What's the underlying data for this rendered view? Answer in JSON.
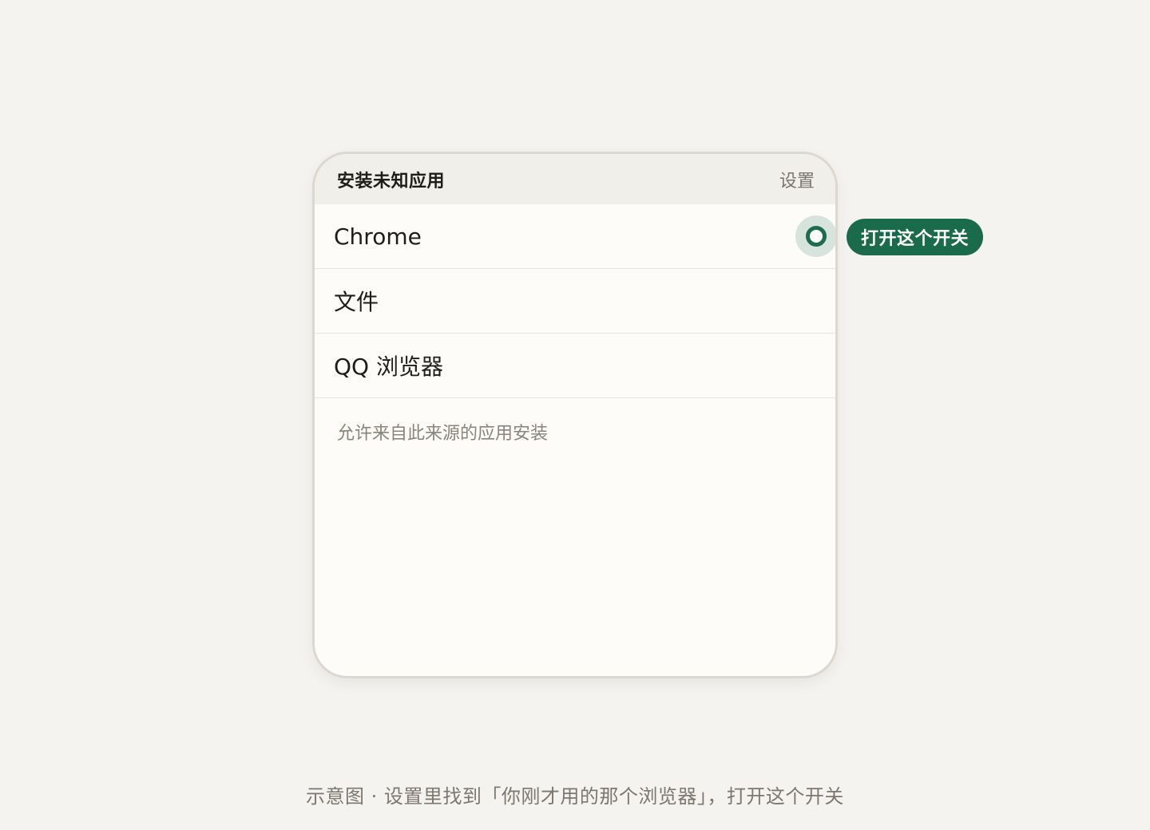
{
  "header": {
    "title": "安装未知应用",
    "action": "设置"
  },
  "rows": [
    {
      "label": "Chrome",
      "toggle": "on"
    },
    {
      "label": "文件"
    },
    {
      "label": "QQ 浏览器"
    }
  ],
  "footnote": "允许来自此来源的应用安装",
  "callout": "打开这个开关",
  "caption": "示意图 · 设置里找到「你刚才用的那个浏览器」，打开这个开关",
  "colors": {
    "accent": "#1a6a4c",
    "background": "#f4f3ef",
    "card": "#fdfcf8"
  }
}
